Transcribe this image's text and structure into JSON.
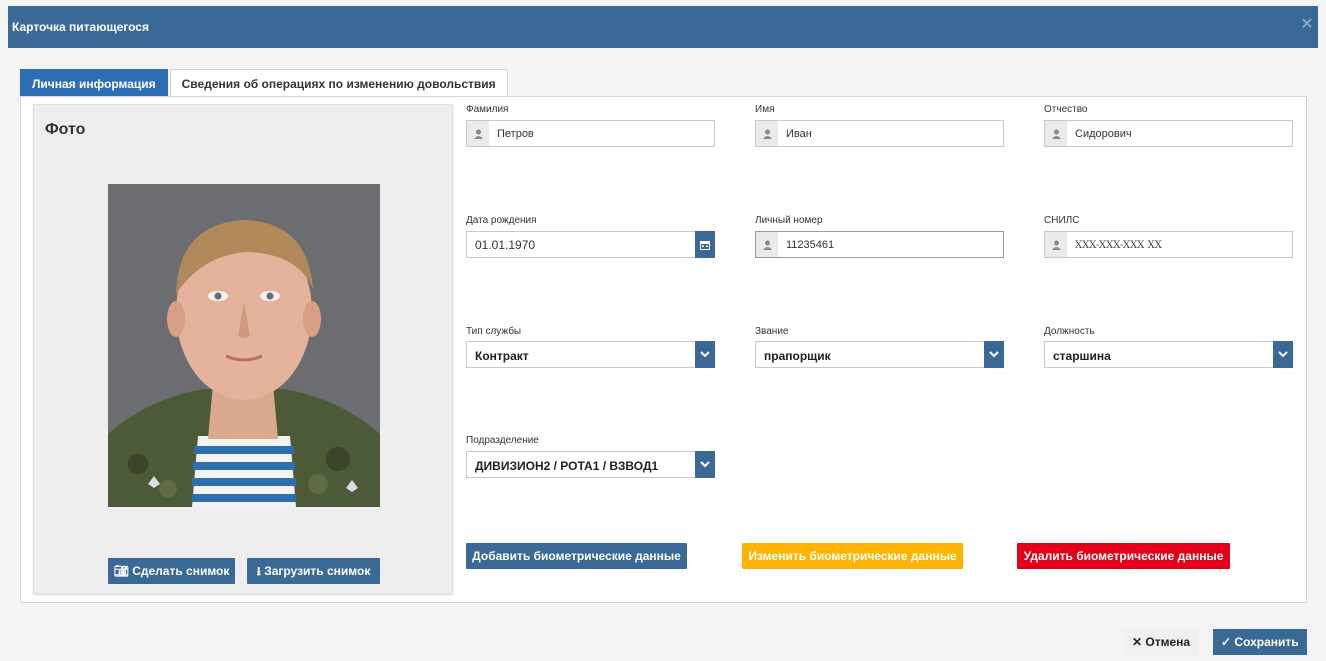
{
  "window": {
    "title": "Карточка питающегося",
    "close_icon": "close-icon"
  },
  "tabs": [
    {
      "label": "Личная информация",
      "active": true
    },
    {
      "label": "Сведения об операциях по изменению довольствия",
      "active": false
    }
  ],
  "photo": {
    "title": "Фото",
    "take_label": "Сделать снимок",
    "upload_label": "Загрузить снимок"
  },
  "fields": {
    "last_name": {
      "label": "Фамилия",
      "value": "Петров",
      "icon": "user-icon"
    },
    "first_name": {
      "label": "Имя",
      "value": "Иван",
      "icon": "user-icon"
    },
    "patronymic": {
      "label": "Отчество",
      "value": "Сидорович",
      "icon": "user-icon"
    },
    "birth_date": {
      "label": "Дата рождения",
      "value": "01.01.1970",
      "icon": "calendar-icon"
    },
    "personal_number": {
      "label": "Личный номер",
      "value": "11235461",
      "icon": "user-icon"
    },
    "snils": {
      "label": "СНИЛС",
      "placeholder": "XXX-XXX-XXX XX",
      "icon": "user-icon"
    },
    "service_type": {
      "label": "Тип службы",
      "value": "Контракт"
    },
    "rank": {
      "label": "Звание",
      "value": "прапорщик"
    },
    "position": {
      "label": "Должность",
      "value": "старшина"
    },
    "unit": {
      "label": "Подразделение",
      "value": "ДИВИЗИОН2 / РОТА1 / ВЗВОД1"
    }
  },
  "biometrics": {
    "add_label": "Добавить биометрические данные",
    "change_label": "Изменить биометрические данные",
    "delete_label": "Удалить биометрические данные"
  },
  "footer": {
    "cancel_label": "Отмена",
    "save_label": "Сохранить"
  },
  "colors": {
    "primary": "#3b6996",
    "tab_active": "#2f6eb5",
    "warning": "#ffb400",
    "danger": "#e3001b"
  }
}
